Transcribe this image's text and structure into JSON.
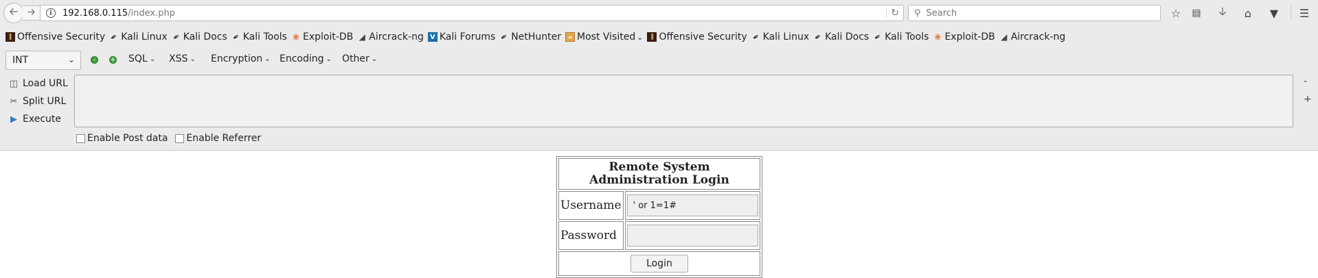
{
  "browser": {
    "url_host": "192.168.0.115",
    "url_path": "/index.php",
    "search_placeholder": "Search"
  },
  "bookmarks": [
    {
      "label": "Offensive Security",
      "icon": "offensive-security-icon"
    },
    {
      "label": "Kali Linux",
      "icon": "kali-dragon-icon"
    },
    {
      "label": "Kali Docs",
      "icon": "kali-dragon-icon"
    },
    {
      "label": "Kali Tools",
      "icon": "kali-dragon-icon"
    },
    {
      "label": "Exploit-DB",
      "icon": "exploit-db-icon"
    },
    {
      "label": "Aircrack-ng",
      "icon": "aircrack-icon"
    },
    {
      "label": "Kali Forums",
      "icon": "kali-forums-icon"
    },
    {
      "label": "NetHunter",
      "icon": "kali-dragon-icon"
    },
    {
      "label": "Most Visited",
      "icon": "folder-icon"
    },
    {
      "label": "Offensive Security",
      "icon": "offensive-security-icon"
    },
    {
      "label": "Kali Linux",
      "icon": "kali-dragon-icon"
    },
    {
      "label": "Kali Docs",
      "icon": "kali-dragon-icon"
    },
    {
      "label": "Kali Tools",
      "icon": "kali-dragon-icon"
    },
    {
      "label": "Exploit-DB",
      "icon": "exploit-db-icon"
    },
    {
      "label": "Aircrack-ng",
      "icon": "aircrack-icon"
    }
  ],
  "hackbar": {
    "select_value": "INT",
    "menus": [
      "SQL",
      "XSS",
      "Encryption",
      "Encoding",
      "Other"
    ],
    "actions": [
      "Load URL",
      "Split URL",
      "Execute"
    ],
    "side_minus": "-",
    "side_plus": "+",
    "enable_post": "Enable Post data",
    "enable_referrer": "Enable Referrer"
  },
  "login": {
    "title": "Remote System Administration Login",
    "username_label": "Username",
    "username_value": "' or 1=1#",
    "password_label": "Password",
    "password_value": "",
    "button_label": "Login"
  }
}
